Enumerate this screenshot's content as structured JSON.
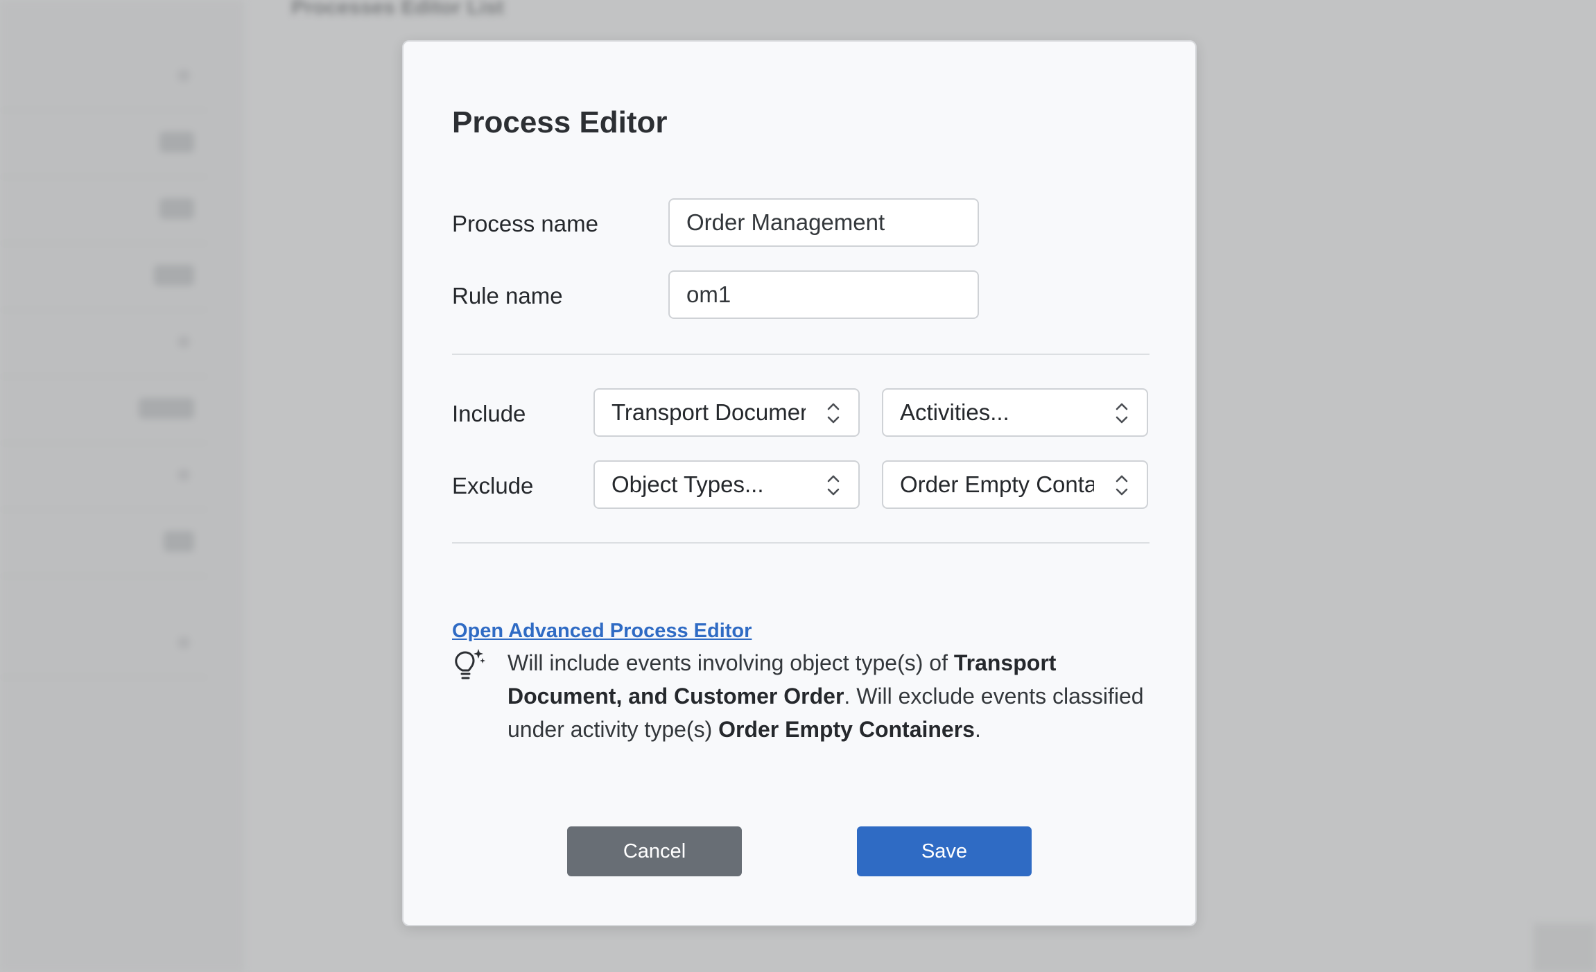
{
  "background": {
    "title": "Processes Editor List"
  },
  "modal": {
    "title": "Process Editor",
    "process_name": {
      "label": "Process name",
      "value": "Order Management"
    },
    "rule_name": {
      "label": "Rule name",
      "value": "om1"
    },
    "include": {
      "label": "Include",
      "object_types_value": "Transport Documer",
      "activities_value": "Activities..."
    },
    "exclude": {
      "label": "Exclude",
      "object_types_value": "Object Types...",
      "activities_value": "Order Empty Conta"
    },
    "advanced_link": "Open Advanced Process Editor",
    "hint": {
      "icon": "lightbulb-sparkle-icon",
      "part1": "Will include events involving object type(s) of ",
      "bold1": "Transport Document, and Customer Order",
      "part2": ". Will exclude events classified under activity type(s) ",
      "bold2": "Order Empty Containers",
      "part3": "."
    },
    "cancel_label": "Cancel",
    "save_label": "Save"
  },
  "colors": {
    "primary": "#2f6bc4",
    "secondary": "#686e75",
    "overlay": "#c2c3c4",
    "modal_bg": "#f8f9fb"
  }
}
